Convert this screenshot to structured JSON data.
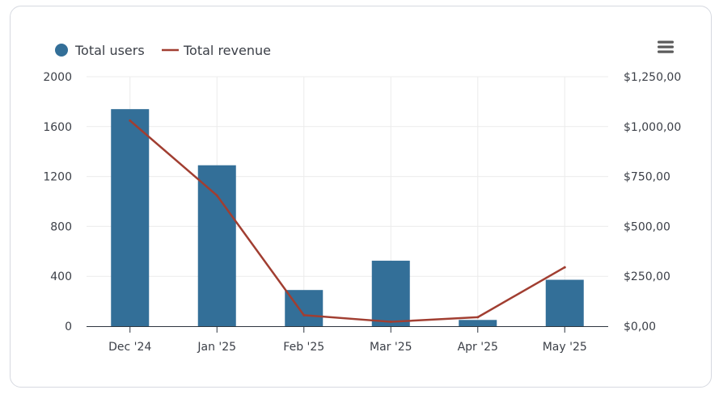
{
  "colors": {
    "bars": "#336f98",
    "line": "#a13e31",
    "grid": "#ececec",
    "axis": "#2e3640",
    "text": "#3b3f47",
    "menu_icon": "#5c5c5c"
  },
  "menu": {
    "icon": "hamburger-menu-icon"
  },
  "chart_data": {
    "type": "bar",
    "categories": [
      "Dec '24",
      "Jan '25",
      "Feb '25",
      "Mar '25",
      "Apr '25",
      "May '25"
    ],
    "series": [
      {
        "name": "Total users",
        "type": "bar",
        "axis": "left",
        "values": [
          1740,
          1290,
          290,
          525,
          50,
          372
        ]
      },
      {
        "name": "Total revenue",
        "type": "line",
        "axis": "right",
        "values": [
          1030,
          655,
          55,
          22,
          45,
          295
        ]
      }
    ],
    "y_left": {
      "min": 0,
      "max": 2000,
      "ticks": [
        0,
        400,
        800,
        1200,
        1600,
        2000
      ],
      "tick_labels": [
        "0",
        "400",
        "800",
        "1200",
        "1600",
        "2000"
      ]
    },
    "y_right": {
      "min": 0,
      "max": 1250,
      "ticks": [
        0,
        250,
        500,
        750,
        1000,
        1250
      ],
      "tick_labels": [
        "$0,00",
        "$250,00",
        "$500,00",
        "$750,00",
        "$1,000,00",
        "$1,250,00"
      ]
    },
    "legend": {
      "position": "top-left",
      "items": [
        "Total users",
        "Total revenue"
      ]
    },
    "grid": true
  }
}
